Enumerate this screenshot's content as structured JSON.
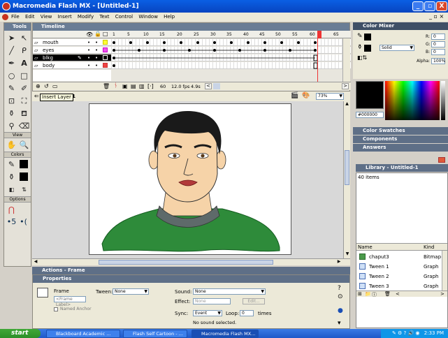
{
  "window": {
    "title": "Macromedia Flash MX - [Untitled-1]",
    "min": "_",
    "max": "▫",
    "close": "X"
  },
  "menu": [
    "File",
    "Edit",
    "View",
    "Insert",
    "Modify",
    "Text",
    "Control",
    "Window",
    "Help"
  ],
  "tools": {
    "title": "Tools",
    "sections": {
      "view": "View",
      "colors": "Colors",
      "options": "Options"
    }
  },
  "timeline": {
    "title": "Timeline",
    "frame_numbers": [
      "1",
      "5",
      "10",
      "15",
      "20",
      "25",
      "30",
      "35",
      "40",
      "45",
      "50",
      "55",
      "60",
      "65"
    ],
    "layers": [
      "mouth",
      "eyes",
      "blkg",
      "body"
    ],
    "status": {
      "current_frame": "60",
      "fps": "12.0 fps",
      "time": "4.9s"
    }
  },
  "stage": {
    "scene": "e 1",
    "zoom": "73%"
  },
  "tooltip": "Insert Layer",
  "actions_panel": {
    "title": "Actions - Frame"
  },
  "properties": {
    "title": "Properties",
    "frame_label": "Frame",
    "frame_placeholder": "<Frame Label>",
    "named_anchor": "Named Anchor",
    "tween_label": "Tween:",
    "tween_value": "None",
    "sound_label": "Sound:",
    "sound_value": "None",
    "effect_label": "Effect:",
    "effect_value": "None",
    "edit": "Edit...",
    "sync_label": "Sync:",
    "sync_value": "Event",
    "loop_label": "Loop:",
    "loop_value": "0",
    "times": "times",
    "no_sound": "No sound selected."
  },
  "color_mixer": {
    "title": "Color Mixer",
    "r_label": "R:",
    "r": "0",
    "g_label": "G:",
    "g": "0",
    "b_label": "B:",
    "b": "0",
    "fill": "Solid",
    "alpha_label": "Alpha:",
    "alpha": "100%",
    "hex": "#000000"
  },
  "panels": {
    "swatches": "Color Swatches",
    "components": "Components",
    "answers": "Answers"
  },
  "library": {
    "title": "Library - Untitled-1",
    "count": "40 items",
    "col_name": "Name",
    "col_kind": "Kind",
    "items": [
      {
        "name": "chaput3",
        "kind": "Bitmap"
      },
      {
        "name": "Tween 1",
        "kind": "Graph"
      },
      {
        "name": "Tween 2",
        "kind": "Graph"
      },
      {
        "name": "Tween 3",
        "kind": "Graph"
      }
    ]
  },
  "taskbar": {
    "start": "start",
    "tasks": [
      "Blackboard Academic ...",
      "Flash Self Cartoon - ...",
      "Macromedia Flash MX..."
    ],
    "clock": "2:33 PM"
  },
  "colors": {
    "accent": "#0a5fe4",
    "panel_head": "#6a7d95",
    "skin": "#f6d3a8",
    "sweater": "#2e8b3a",
    "collar": "#5e6a6a",
    "hair": "#1a1a1a"
  }
}
